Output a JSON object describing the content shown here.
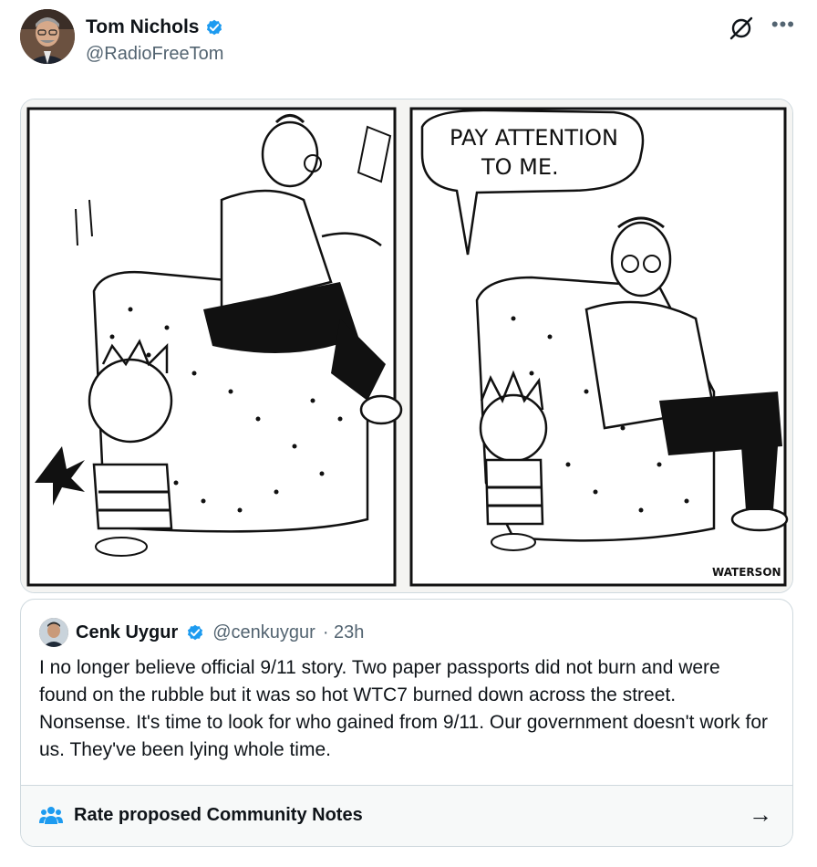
{
  "author": {
    "name": "Tom Nichols",
    "handle": "@RadioFreeTom"
  },
  "comic": {
    "speech_bubble": "PAY ATTENTION\nTO ME.",
    "signature": "WATERSON"
  },
  "quoted_post": {
    "name": "Cenk Uygur",
    "handle": "@cenkuygur",
    "time": "· 23h",
    "text": "I no longer believe official 9/11 story. Two paper passports did not burn and were found on the rubble but it was so hot WTC7 burned down across the street. Nonsense. It's time to look for who gained from 9/11. Our government doesn't work for us. They've been lying whole time."
  },
  "community_notes": {
    "label": "Rate proposed Community Notes"
  },
  "colors": {
    "verified_blue": "#1d9bf0",
    "text_primary": "#0f1419",
    "text_secondary": "#536471",
    "border": "#cfd9de"
  },
  "icons": [
    "verified-badge-icon",
    "grok-icon",
    "more-icon",
    "community-notes-icon",
    "arrow-right-icon"
  ]
}
